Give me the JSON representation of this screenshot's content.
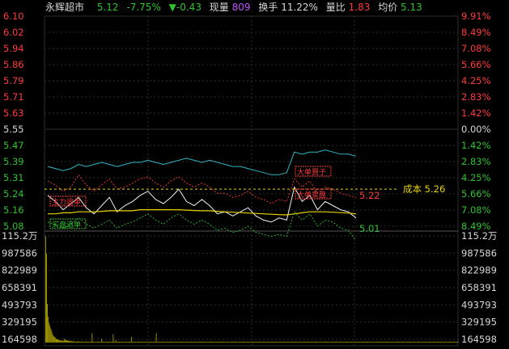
{
  "colors": {
    "up": "#ff3b3b",
    "down": "#2fc22f",
    "neutral": "#d8d8d8",
    "yellow": "#e6d300",
    "cyan": "#31b5c4",
    "white": "#f2f2f2",
    "purple": "#c050ff",
    "volume": "#bdb300",
    "grid": "#2e2e2e"
  },
  "header": {
    "name": "永辉超市",
    "price": "5.12",
    "pct": "-7.75%",
    "change": "▼-0.43",
    "vol_label": "现量",
    "vol_value": "809",
    "turnover_label": "换手",
    "turnover_value": "11.22%",
    "ratio_label": "量比",
    "ratio_value": "1.83",
    "avg_label": "均价",
    "avg_value": "5.13"
  },
  "price_axis": {
    "left": [
      "6.10",
      "6.02",
      "5.94",
      "5.86",
      "5.79",
      "5.71",
      "5.63",
      "5.55",
      "5.47",
      "5.39",
      "5.31",
      "5.24",
      "5.16",
      "5.08"
    ],
    "right": [
      "9.91%",
      "8.49%",
      "7.08%",
      "5.66%",
      "4.25%",
      "2.83%",
      "1.42%",
      "0.00%",
      "1.42%",
      "2.83%",
      "4.25%",
      "5.66%",
      "7.08%",
      "8.49%"
    ]
  },
  "volume_axis": {
    "left": [
      "115.2万",
      "987586",
      "822989",
      "658391",
      "493793",
      "329195",
      "164598"
    ],
    "right": [
      "115.2万",
      "987586",
      "822989",
      "658391",
      "493793",
      "329195",
      "164598"
    ]
  },
  "annotations": {
    "cost_label": "成本 5.26",
    "high_label": "5.22",
    "low_label": "5.01",
    "tag1": "主力追单",
    "tag2": "大单買子",
    "tag3": "抵消砸盘",
    "tag4": "大单卖盘",
    "tag5": "买盘追单"
  },
  "chart_data": {
    "type": "line",
    "ylim": [
      5.08,
      6.1
    ],
    "series": [
      {
        "values": [
          5.37,
          5.36,
          5.35,
          5.36,
          5.38,
          5.37,
          5.38,
          5.39,
          5.38,
          5.37,
          5.38,
          5.39,
          5.39,
          5.4,
          5.39,
          5.38,
          5.39,
          5.4,
          5.41,
          5.4,
          5.39,
          5.4,
          5.39,
          5.38,
          5.37,
          5.37,
          5.36,
          5.35,
          5.34,
          5.33,
          5.33,
          5.34,
          5.44,
          5.43,
          5.44,
          5.44,
          5.45,
          5.44,
          5.43,
          5.43,
          5.42
        ]
      },
      {
        "values": [
          5.23,
          5.2,
          5.16,
          5.19,
          5.22,
          5.17,
          5.14,
          5.18,
          5.22,
          5.15,
          5.18,
          5.2,
          5.23,
          5.25,
          5.21,
          5.19,
          5.22,
          5.26,
          5.2,
          5.18,
          5.21,
          5.18,
          5.14,
          5.15,
          5.13,
          5.15,
          5.17,
          5.13,
          5.11,
          5.1,
          5.12,
          5.11,
          5.27,
          5.2,
          5.23,
          5.16,
          5.2,
          5.18,
          5.16,
          5.15,
          5.12
        ]
      },
      {
        "values": [
          5.14,
          5.14,
          5.145,
          5.145,
          5.15,
          5.15,
          5.15,
          5.152,
          5.155,
          5.155,
          5.155,
          5.155,
          5.16,
          5.16,
          5.16,
          5.16,
          5.16,
          5.16,
          5.158,
          5.156,
          5.155,
          5.155,
          5.152,
          5.15,
          5.148,
          5.146,
          5.144,
          5.142,
          5.14,
          5.138,
          5.136,
          5.135,
          5.14,
          5.145,
          5.15,
          5.15,
          5.15,
          5.148,
          5.146,
          5.144,
          5.14
        ]
      },
      {
        "values": [
          5.3,
          5.28,
          5.25,
          5.27,
          5.33,
          5.28,
          5.25,
          5.28,
          5.31,
          5.26,
          5.27,
          5.29,
          5.31,
          5.32,
          5.29,
          5.27,
          5.3,
          5.32,
          5.29,
          5.27,
          5.29,
          5.27,
          5.24,
          5.24,
          5.22,
          5.23,
          5.25,
          5.22,
          5.21,
          5.19,
          5.21,
          5.2,
          5.31,
          5.27,
          5.3,
          5.24,
          5.27,
          5.26,
          5.24,
          5.23,
          5.22
        ]
      },
      {
        "values": [
          5.1,
          5.09,
          5.07,
          5.09,
          5.12,
          5.09,
          5.07,
          5.09,
          5.11,
          5.07,
          5.09,
          5.1,
          5.12,
          5.14,
          5.11,
          5.09,
          5.12,
          5.14,
          5.11,
          5.09,
          5.11,
          5.09,
          5.06,
          5.07,
          5.05,
          5.06,
          5.08,
          5.05,
          5.04,
          5.03,
          5.04,
          5.03,
          5.15,
          5.11,
          5.14,
          5.08,
          5.11,
          5.1,
          5.07,
          5.06,
          5.01
        ]
      }
    ],
    "volume": [
      1150000,
      960000,
      420000,
      280000,
      210000,
      180000,
      150000,
      120000,
      90000,
      70000,
      60000,
      55000,
      40000,
      35000,
      30000,
      32000,
      28000,
      25000,
      20000,
      22000,
      18000,
      40000,
      30000,
      25000,
      24000,
      20000,
      18000,
      19000,
      17000,
      16000,
      15000,
      14000,
      12000,
      10000,
      11000,
      9000,
      10000,
      11000,
      10000,
      9000,
      12000,
      10000,
      9000,
      8000,
      9000,
      10000,
      8000,
      9000,
      8000,
      7000,
      9000,
      8000,
      9000,
      100000,
      8000,
      9000,
      7000,
      8000,
      7000,
      9000,
      8000,
      9000,
      7000,
      8000,
      40000,
      9000,
      8000,
      9000,
      8000,
      7000,
      9000,
      8000,
      9000,
      8000,
      7000,
      9000,
      8000,
      90000,
      8000,
      9000,
      30000,
      9000,
      8000,
      7000,
      9000,
      8000,
      7000,
      9000,
      8000,
      7000,
      9000,
      8000,
      7000,
      9000,
      8000,
      7000,
      9000,
      8000,
      60000,
      9000,
      8000,
      7000,
      9000,
      8000,
      7000,
      9000,
      8000,
      7000,
      9000,
      8000,
      7000,
      9000,
      8000,
      7000,
      9000,
      8000,
      7000,
      9000,
      8000,
      7000,
      9000,
      8000,
      7000,
      9000,
      8000,
      7000,
      100000,
      8000,
      7000,
      9000,
      8000,
      7000,
      9000,
      8000,
      7000,
      9000,
      8000,
      7000,
      9000,
      8000,
      7000,
      9000,
      8000,
      7000,
      9000,
      8000,
      7000,
      9000,
      8000,
      7000,
      9000,
      8000,
      7000,
      9000,
      8000,
      7000,
      9000,
      8000,
      7000,
      9000,
      8000,
      7000,
      9000,
      8000,
      7000,
      9000,
      8000,
      7000,
      9000,
      8000,
      7000,
      9000,
      8000,
      7000,
      9000,
      8000,
      7000,
      9000,
      8000,
      7000,
      9000,
      8000,
      7000,
      9000,
      8000,
      7000,
      9000,
      8000,
      7000,
      9000,
      8000,
      7000,
      9000,
      8000,
      7000,
      9000,
      8000,
      7000,
      9000,
      8000,
      7000,
      9000,
      8000,
      7000,
      9000,
      8000,
      7000,
      9000,
      8000,
      7000,
      9000,
      8000,
      7000,
      9000,
      8000,
      7000,
      9000,
      8000,
      7000,
      9000,
      8000,
      7000,
      9000,
      8000,
      7000,
      9000,
      8000,
      7000,
      9000,
      8000,
      7000,
      9000,
      8000,
      7000,
      9000,
      8000,
      7000,
      9000,
      8000,
      7000,
      9000,
      8000,
      7000,
      9000,
      8000,
      7000,
      9000,
      8000,
      7000,
      9000,
      8000,
      7000,
      9000,
      8000,
      7000,
      9000,
      8000,
      7000,
      9000,
      8000,
      7000,
      9000,
      8000,
      7000,
      9000,
      8000,
      7000,
      9000,
      8000,
      7000,
      9000,
      8000,
      7000,
      9000,
      8000,
      7000,
      9000,
      8000,
      7000,
      9000,
      8000,
      7000,
      9000,
      8000,
      7000,
      9000,
      8000,
      7000,
      9000,
      8000,
      7000,
      9000,
      8000,
      7000,
      9000,
      8000,
      7000,
      9000,
      8000,
      7000,
      9000,
      8000,
      7000,
      9000,
      8000,
      7000,
      9000,
      8000,
      7000,
      9000,
      8000,
      7000,
      9000,
      8000,
      7000,
      9000,
      8000,
      7000,
      9000,
      8000,
      7000,
      9000,
      8000,
      7000,
      9000,
      8000,
      7000,
      9000,
      8000,
      7000,
      9000,
      8000,
      7000,
      9000,
      8000,
      7000,
      9000,
      8000,
      7000,
      9000,
      8000,
      7000,
      9000,
      8000,
      7000,
      9000,
      8000,
      7000,
      9000,
      8000,
      7000,
      9000,
      8000,
      7000,
      9000,
      8000,
      7000,
      9000,
      8000,
      7000,
      9000,
      8000,
      7000,
      9000,
      8000,
      7000,
      9000,
      8000,
      7000,
      9000,
      8000,
      7000,
      9000,
      8000,
      7000,
      9000,
      8000,
      7000,
      9000,
      8000,
      7000,
      9000,
      8000,
      7000,
      9000,
      8000,
      7000,
      9000,
      8000,
      7000,
      9000,
      8000,
      7000,
      9000,
      8000,
      7000,
      9000,
      8000,
      7000,
      9000,
      8000,
      7000,
      9000,
      8000,
      7000,
      9000,
      8000,
      7000,
      9000,
      8000,
      7000,
      9000,
      8000,
      7000,
      9000,
      8000,
      7000,
      9000,
      8000,
      7000,
      9000,
      8000,
      7000,
      9000,
      8000,
      7000,
      9000,
      8000,
      7000,
      9000,
      8000,
      7000,
      9000,
      8000,
      7000,
      9000,
      8000,
      7000,
      9000,
      8000,
      7000,
      9000,
      8000,
      7000,
      9000,
      8000,
      7000,
      9000,
      8000,
      7000,
      9000,
      8000,
      7000,
      9000,
      8000,
      7000,
      9000,
      8000,
      7000,
      9000,
      8000,
      7000,
      9000,
      8000,
      7000,
      9000,
      8000,
      7000,
      9000,
      8000,
      7000
    ]
  }
}
